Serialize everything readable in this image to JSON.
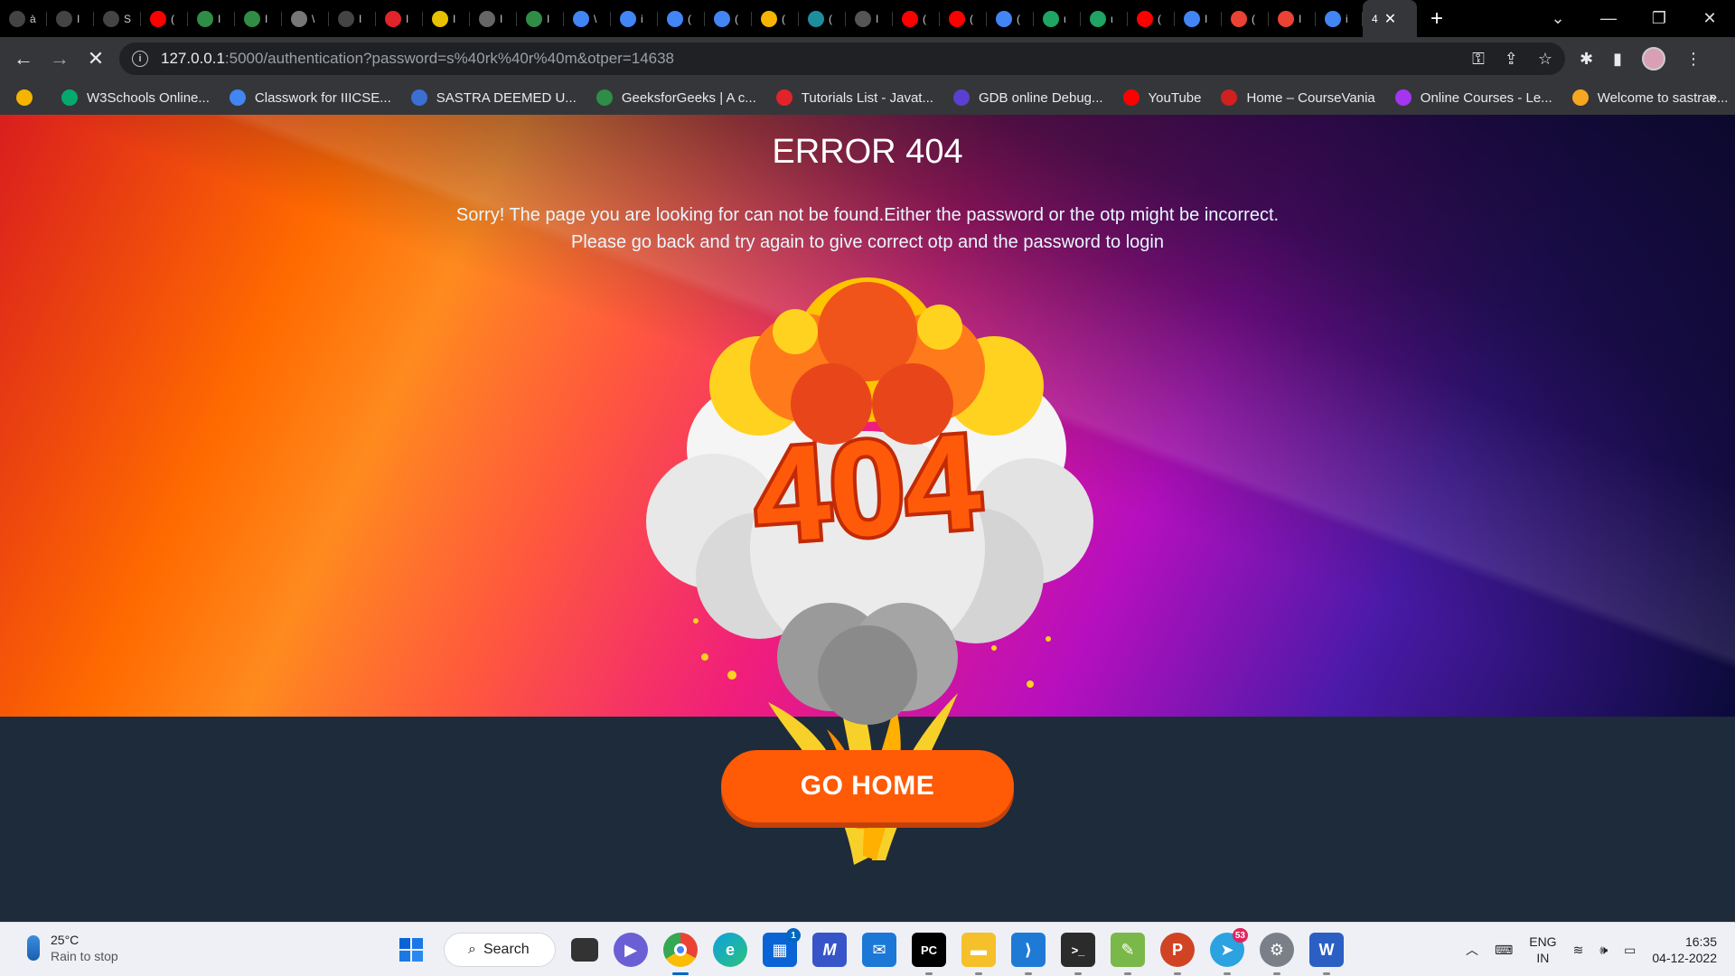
{
  "browser": {
    "tabs": [
      {
        "label": "à",
        "icon": "globe-icon",
        "color": "#444"
      },
      {
        "label": "I",
        "icon": "globe-icon",
        "color": "#444"
      },
      {
        "label": "S",
        "icon": "globe-icon",
        "color": "#444"
      },
      {
        "label": "(",
        "icon": "youtube-icon",
        "color": "#ff0000"
      },
      {
        "label": "I",
        "icon": "gfg-icon",
        "color": "#2f8d46"
      },
      {
        "label": "I",
        "icon": "gfg-icon",
        "color": "#2f8d46"
      },
      {
        "label": "\\",
        "icon": "page-icon",
        "color": "#777"
      },
      {
        "label": "I",
        "icon": "globe-icon",
        "color": "#444"
      },
      {
        "label": "I",
        "icon": "vivaldi-icon",
        "color": "#e0242a"
      },
      {
        "label": "I",
        "icon": "app-icon",
        "color": "#e8c200"
      },
      {
        "label": "I",
        "icon": "m-icon",
        "color": "#666"
      },
      {
        "label": "I",
        "icon": "gfg-icon",
        "color": "#2f8d46"
      },
      {
        "label": "\\",
        "icon": "google-icon",
        "color": "#4285f4"
      },
      {
        "label": "i",
        "icon": "google-icon",
        "color": "#4285f4"
      },
      {
        "label": "(",
        "icon": "google-icon",
        "color": "#4285f4"
      },
      {
        "label": "(",
        "icon": "google-icon",
        "color": "#4285f4"
      },
      {
        "label": "(",
        "icon": "classroom-icon",
        "color": "#f4b400"
      },
      {
        "label": "(",
        "icon": "classroom-icon",
        "color": "#1e8e9e"
      },
      {
        "label": "I",
        "icon": "openai-icon",
        "color": "#555"
      },
      {
        "label": "(",
        "icon": "youtube-icon",
        "color": "#ff0000"
      },
      {
        "label": "(",
        "icon": "youtube-icon",
        "color": "#ff0000"
      },
      {
        "label": "(",
        "icon": "google-icon",
        "color": "#4285f4"
      },
      {
        "label": "ι",
        "icon": "drive-icon",
        "color": "#1fa463"
      },
      {
        "label": "ι",
        "icon": "drive-icon",
        "color": "#1fa463"
      },
      {
        "label": "(",
        "icon": "youtube-icon",
        "color": "#ff0000"
      },
      {
        "label": "I",
        "icon": "google-icon",
        "color": "#4285f4"
      },
      {
        "label": "(",
        "icon": "gmail-icon",
        "color": "#ea4335"
      },
      {
        "label": "I",
        "icon": "gmail-icon",
        "color": "#ea4335"
      },
      {
        "label": "i",
        "icon": "google-icon",
        "color": "#4285f4"
      }
    ],
    "active_tab": {
      "label": "4"
    },
    "url_host": "127.0.0.1",
    "url_rest": ":5000/authentication?password=s%40rk%40r%40m&otper=14638",
    "bookmarks": [
      {
        "label": "",
        "icon": "classroom-icon",
        "color": "#f4b400"
      },
      {
        "label": "W3Schools Online...",
        "icon": "w3schools-icon",
        "color": "#04aa6d"
      },
      {
        "label": "Classwork for IIICSE...",
        "icon": "google-icon",
        "color": "#4285f4"
      },
      {
        "label": "SASTRA DEEMED U...",
        "icon": "sastra-icon",
        "color": "#3b6fd4"
      },
      {
        "label": "GeeksforGeeks | A c...",
        "icon": "gfg-icon",
        "color": "#2f8d46"
      },
      {
        "label": "Tutorials List - Javat...",
        "icon": "javatpoint-icon",
        "color": "#e0242a"
      },
      {
        "label": "GDB online Debug...",
        "icon": "gdb-icon",
        "color": "#5a3fd1"
      },
      {
        "label": "YouTube",
        "icon": "youtube-icon",
        "color": "#ff0000"
      },
      {
        "label": "Home – CourseVania",
        "icon": "coursevania-icon",
        "color": "#d02020"
      },
      {
        "label": "Online Courses - Le...",
        "icon": "udemy-icon",
        "color": "#a435f0"
      },
      {
        "label": "Welcome to sastrae...",
        "icon": "sun-icon",
        "color": "#f5a623"
      }
    ]
  },
  "page": {
    "title": "ERROR 404",
    "message_line1": "Sorry! The page you are looking for can not be found.Either the password or the otp might be incorrect.",
    "message_line2": "Please go back and try again to give correct otp and the password to login",
    "illustration_text": "404",
    "button_label": "GO HOME"
  },
  "taskbar": {
    "weather_temp": "25°C",
    "weather_desc": "Rain to stop",
    "search_label": "Search",
    "edge_badge": "1",
    "telegram_badge": "53",
    "lang_line1": "ENG",
    "lang_line2": "IN",
    "time": "16:35",
    "date": "04-12-2022"
  },
  "colors": {
    "button": "#ff5a05",
    "page_bottom": "#1e2b3a"
  }
}
